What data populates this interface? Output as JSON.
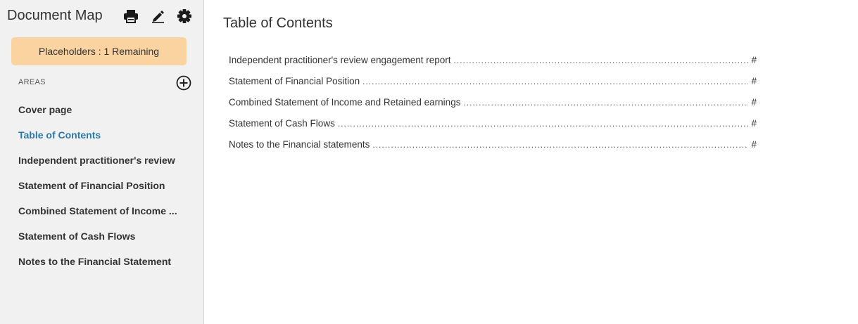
{
  "sidebar": {
    "title": "Document Map",
    "tools": [
      {
        "name": "print-icon"
      },
      {
        "name": "edit-icon"
      },
      {
        "name": "gear-icon"
      }
    ],
    "placeholders": "Placeholders : 1 Remaining",
    "areas_label": "AREAS",
    "items": [
      {
        "label": "Cover page",
        "active": false
      },
      {
        "label": "Table of Contents",
        "active": true
      },
      {
        "label": "Independent practitioner's review",
        "active": false
      },
      {
        "label": "Statement of Financial Position",
        "active": false
      },
      {
        "label": "Combined Statement of Income ...",
        "active": false
      },
      {
        "label": "Statement of Cash Flows",
        "active": false
      },
      {
        "label": "Notes to the Financial Statement",
        "active": false
      }
    ],
    "active_color": "#2a79a8",
    "banner_color": "#fbd3a1"
  },
  "main": {
    "title": "Table of Contents",
    "toc": [
      {
        "text": "Independent practitioner's review engagement report",
        "page": "#"
      },
      {
        "text": "Statement of Financial Position",
        "page": "#"
      },
      {
        "text": "Combined Statement of Income and Retained earnings",
        "page": "#"
      },
      {
        "text": "Statement of Cash Flows",
        "page": "#"
      },
      {
        "text": "Notes to the Financial statements",
        "page": "#"
      }
    ]
  }
}
